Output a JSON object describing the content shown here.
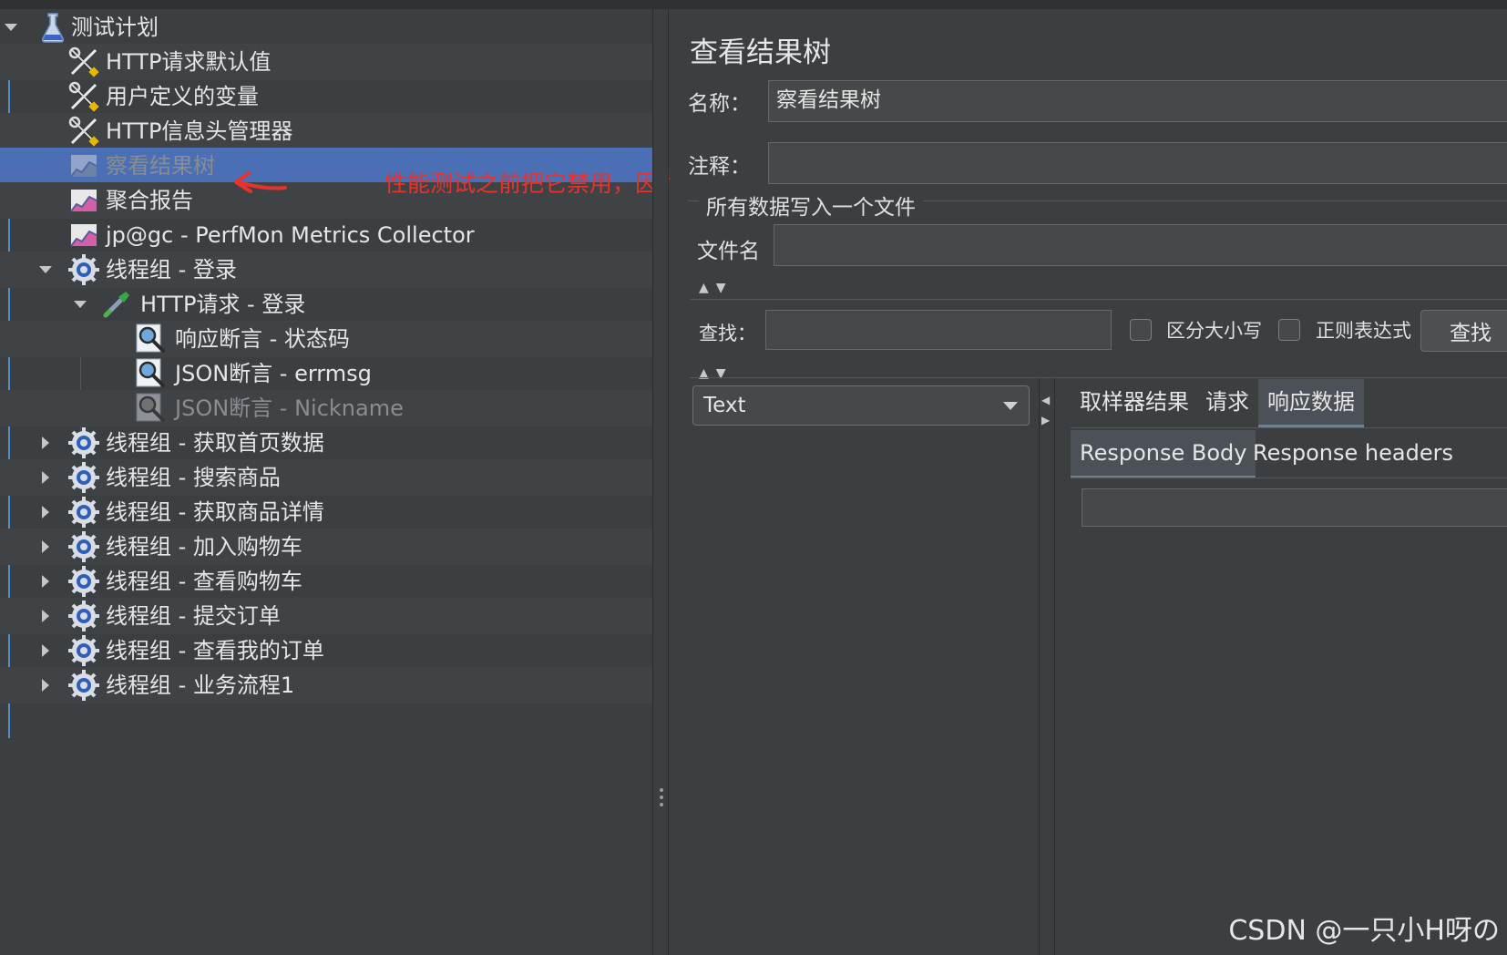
{
  "tree": {
    "items": [
      {
        "label": "测试计划",
        "icon": "flask-icon",
        "level": 0,
        "expanded": true
      },
      {
        "label": "HTTP请求默认值",
        "icon": "tools-icon",
        "level": 1
      },
      {
        "label": "用户定义的变量",
        "icon": "tools-icon",
        "level": 1
      },
      {
        "label": "HTTP信息头管理器",
        "icon": "tools-icon",
        "level": 1
      },
      {
        "label": "察看结果树",
        "icon": "chart-listener-icon",
        "level": 1,
        "selected": true,
        "disabled": true
      },
      {
        "label": "聚合报告",
        "icon": "chart-listener-icon",
        "level": 1
      },
      {
        "label": "jp@gc - PerfMon Metrics Collector",
        "icon": "chart-listener-icon",
        "level": 1
      },
      {
        "label": "线程组 - 登录",
        "icon": "gear-icon",
        "level": 1,
        "expanded": true
      },
      {
        "label": "HTTP请求 - 登录",
        "icon": "pipette-icon",
        "level": 2,
        "expanded": true
      },
      {
        "label": "响应断言 - 状态码",
        "icon": "magnifier-icon",
        "level": 3
      },
      {
        "label": "JSON断言 - errmsg",
        "icon": "magnifier-icon",
        "level": 3
      },
      {
        "label": "JSON断言 - Nickname",
        "icon": "magnifier-icon",
        "level": 3,
        "disabled": true
      },
      {
        "label": "线程组 - 获取首页数据",
        "icon": "gear-icon",
        "level": 1,
        "expanded": false
      },
      {
        "label": "线程组 - 搜索商品",
        "icon": "gear-icon",
        "level": 1,
        "expanded": false
      },
      {
        "label": "线程组 - 获取商品详情",
        "icon": "gear-icon",
        "level": 1,
        "expanded": false
      },
      {
        "label": "线程组 - 加入购物车",
        "icon": "gear-icon",
        "level": 1,
        "expanded": false
      },
      {
        "label": "线程组 - 查看购物车",
        "icon": "gear-icon",
        "level": 1,
        "expanded": false
      },
      {
        "label": "线程组 - 提交订单",
        "icon": "gear-icon",
        "level": 1,
        "expanded": false
      },
      {
        "label": "线程组 - 查看我的订单",
        "icon": "gear-icon",
        "level": 1,
        "expanded": false
      },
      {
        "label": "线程组 - 业务流程1",
        "icon": "gear-icon",
        "level": 1,
        "expanded": false
      }
    ]
  },
  "annotation": {
    "text": "性能测试之前把它禁用，因为打开解析会消耗系统资源",
    "color": "#e8322b"
  },
  "panel": {
    "title": "查看结果树",
    "name_label": "名称：",
    "name_value": "察看结果树",
    "comment_label": "注释：",
    "comment_value": "",
    "file_group_title": "所有数据写入一个文件",
    "filename_label": "文件名",
    "filename_value": "",
    "search_label": "查找：",
    "search_value": "",
    "case_sensitive_label": "区分大小写",
    "regex_label": "正则表达式",
    "search_button": "查找",
    "renderer_selected": "Text",
    "tabs": [
      "取样器结果",
      "请求",
      "响应数据"
    ],
    "active_tab": "响应数据",
    "subtabs": [
      "Response Body",
      "Response headers"
    ],
    "active_subtab": "Response Body"
  },
  "watermark": "CSDN @一只小H呀の",
  "colors": {
    "selection": "#4a6fb5",
    "background": "#3c3f41",
    "annotation": "#e8322b"
  }
}
